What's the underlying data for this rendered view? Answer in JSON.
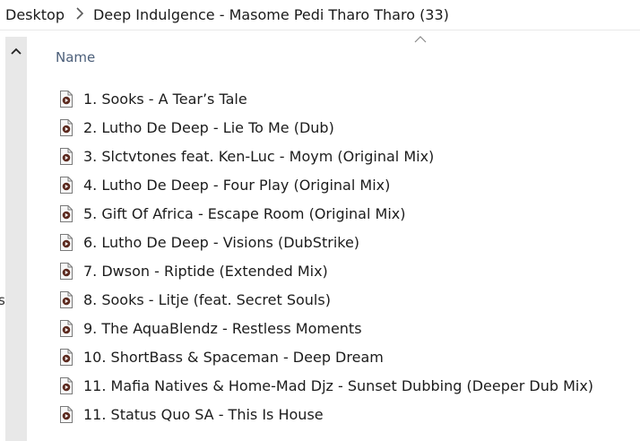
{
  "breadcrumb": {
    "root": "Desktop",
    "folder": "Deep Indulgence - Masome Pedi Tharo Tharo (33)"
  },
  "left_edge_char": "s",
  "list": {
    "column_header": "Name",
    "files": [
      {
        "name": "1. Sooks - A Tear’s Tale"
      },
      {
        "name": "2. Lutho De Deep - Lie To Me (Dub)"
      },
      {
        "name": "3. Slctvtones feat. Ken-Luc - Moym (Original Mix)"
      },
      {
        "name": "4. Lutho De Deep - Four Play (Original Mix)"
      },
      {
        "name": "5. Gift Of Africa - Escape Room (Original Mix)"
      },
      {
        "name": "6. Lutho De Deep - Visions (DubStrike)"
      },
      {
        "name": "7. Dwson - Riptide (Extended Mix)"
      },
      {
        "name": "8. Sooks - Litje (feat. Secret Souls)"
      },
      {
        "name": "9. The AquaBlendz - Restless Moments"
      },
      {
        "name": "10. ShortBass & Spaceman - Deep Dream"
      },
      {
        "name": "11. Mafia Natives & Home-Mad Djz - Sunset Dubbing (Deeper Dub Mix)"
      },
      {
        "name": "11. Status Quo SA - This Is House"
      }
    ]
  },
  "icons": {
    "breadcrumb_separator": "chevron-right-icon",
    "scroll_up": "chevron-up-icon",
    "sort": "sort-ascending-icon",
    "file": "media-file-icon"
  },
  "colors": {
    "header_text": "#4c5f7a",
    "scrollbar": "#e8e8e8",
    "icon_border": "#7a7a7a",
    "icon_play": "#5c2a1f"
  }
}
